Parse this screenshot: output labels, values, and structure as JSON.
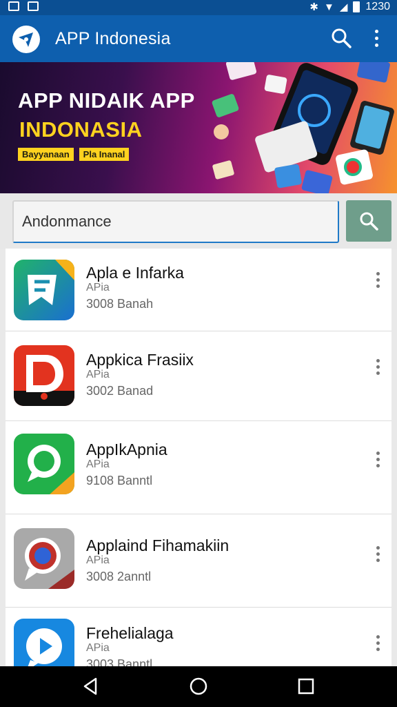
{
  "status_bar": {
    "time": "1230"
  },
  "app_bar": {
    "title": "APP Indonesia"
  },
  "banner": {
    "line1": "APP NIDAIK APP",
    "line2": "INDONASIA",
    "tag1": "Bayyanaan",
    "tag2": "Pla Inanal"
  },
  "search": {
    "value": "Andonmance"
  },
  "apps": [
    {
      "name": "Apla e Infarka",
      "developer": "APia",
      "stat": "3008 Banah"
    },
    {
      "name": "Appkica Frasiix",
      "developer": "APia",
      "stat": "3002 Banad"
    },
    {
      "name": "AppIkApnia",
      "developer": "APia",
      "stat": "9108 Banntl"
    },
    {
      "name": "Applaind Fihamakiin",
      "developer": "APia",
      "stat": "3008 2anntl"
    },
    {
      "name": "Frehelialaga",
      "developer": "APia",
      "stat": "3003 Banntl"
    }
  ],
  "icon_badges": {
    "app2": "AV",
    "app3": "AV",
    "app4": "AE"
  },
  "colors": {
    "app_bar": "#0e5fae",
    "status_bar": "#0b4f93",
    "banner_accent": "#ffd21f",
    "search_button": "#6f9e8b"
  }
}
